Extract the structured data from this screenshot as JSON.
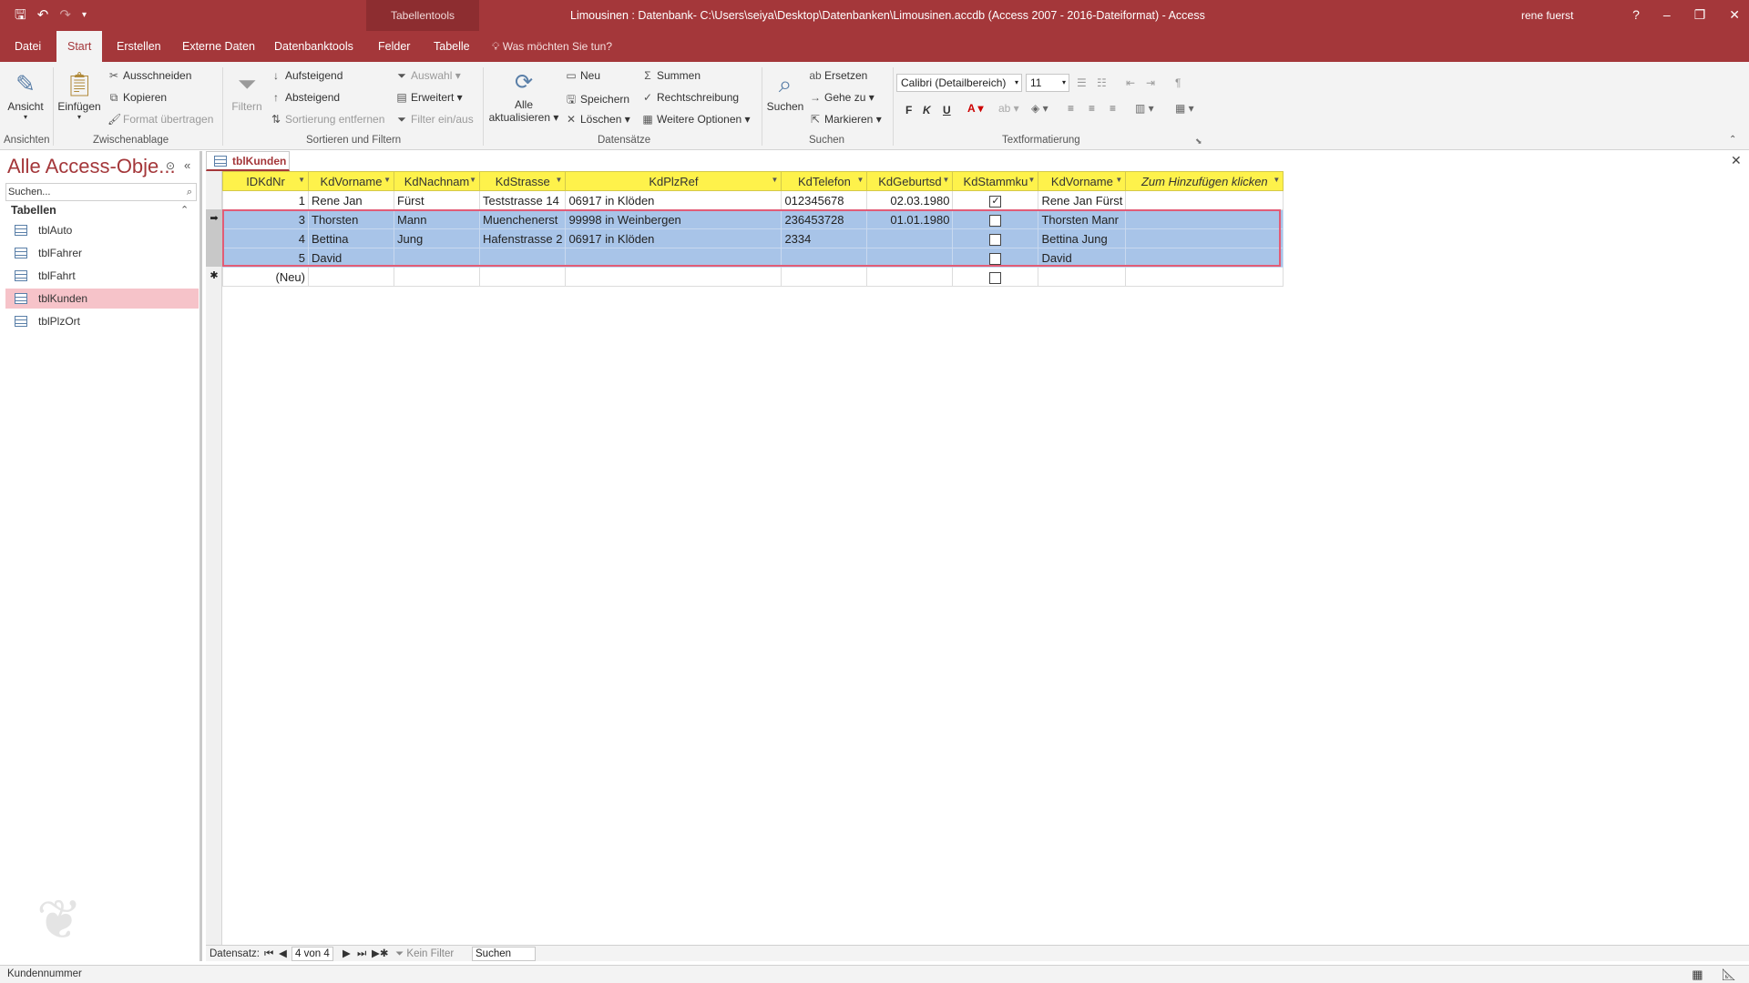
{
  "titlebar": {
    "tooltab": "Tabellentools",
    "title": "Limousinen : Datenbank- C:\\Users\\seiya\\Desktop\\Datenbanken\\Limousinen.accdb (Access 2007 - 2016-Dateiformat)  -  Access",
    "user": "rene fuerst",
    "help": "?",
    "minimize": "–",
    "restore": "❐",
    "close": "✕"
  },
  "tabs": {
    "datei": "Datei",
    "start": "Start",
    "erstellen": "Erstellen",
    "externe": "Externe Daten",
    "dbtools": "Datenbanktools",
    "felder": "Felder",
    "tabelle": "Tabelle",
    "tellme": "Was möchten Sie tun?"
  },
  "ribbon": {
    "ansicht": "Ansicht",
    "einfuegen": "Einfügen",
    "ausschneiden": "Ausschneiden",
    "kopieren": "Kopieren",
    "format_uebertragen": "Format übertragen",
    "filtern": "Filtern",
    "aufsteigend": "Aufsteigend",
    "absteigend": "Absteigend",
    "sortierung_entfernen": "Sortierung entfernen",
    "auswahl": "Auswahl",
    "erweitert": "Erweitert",
    "filter_einaus": "Filter ein/aus",
    "alle_aktualisieren_1": "Alle",
    "alle_aktualisieren_2": "aktualisieren",
    "neu": "Neu",
    "speichern": "Speichern",
    "loeschen": "Löschen",
    "summen": "Summen",
    "rechtschreibung": "Rechtschreibung",
    "weitere_optionen": "Weitere Optionen",
    "suchen": "Suchen",
    "ersetzen": "Ersetzen",
    "gehe_zu": "Gehe zu",
    "markieren": "Markieren",
    "font_name": "Calibri (Detailbereich)",
    "font_size": "11",
    "bold": "F",
    "italic": "K",
    "underline": "U",
    "groups": {
      "ansichten": "Ansichten",
      "zwischenablage": "Zwischenablage",
      "sortieren": "Sortieren und Filtern",
      "datensaetze": "Datensätze",
      "suchen": "Suchen",
      "textformatierung": "Textformatierung"
    }
  },
  "nav": {
    "header": "Alle Access-Obje...",
    "search_placeholder": "Suchen...",
    "section": "Tabellen",
    "items": [
      "tblAuto",
      "tblFahrer",
      "tblFahrt",
      "tblKunden",
      "tblPlzOrt"
    ],
    "selected": "tblKunden"
  },
  "document": {
    "tab": "tblKunden",
    "columns": [
      "IDKdNr",
      "KdVorname",
      "KdNachnam",
      "KdStrasse",
      "KdPlzRef",
      "KdTelefon",
      "KdGeburtsd",
      "KdStammku",
      "KdVorname",
      "Zum Hinzufügen klicken"
    ],
    "rows": [
      {
        "id": "1",
        "vorname": "Rene Jan",
        "nachname": "Fürst",
        "strasse": "Teststrasse 14",
        "plz": "06917 in Klöden",
        "telefon": "012345678",
        "geburt": "02.03.1980",
        "stammkunde": true,
        "vollname": "Rene Jan Fürst",
        "selected": false
      },
      {
        "id": "3",
        "vorname": "Thorsten",
        "nachname": "Mann",
        "strasse": "Muenchenerst",
        "plz": "99998 in Weinbergen",
        "telefon": "236453728",
        "geburt": "01.01.1980",
        "stammkunde": false,
        "vollname": "Thorsten Manr",
        "selected": true
      },
      {
        "id": "4",
        "vorname": "Bettina",
        "nachname": "Jung",
        "strasse": "Hafenstrasse 2",
        "plz": "06917 in Klöden",
        "telefon": "2334",
        "geburt": "",
        "stammkunde": false,
        "vollname": "Bettina Jung",
        "selected": true
      },
      {
        "id": "5",
        "vorname": "David",
        "nachname": "",
        "strasse": "",
        "plz": "",
        "telefon": "",
        "geburt": "",
        "stammkunde": false,
        "vollname": "David",
        "selected": true
      }
    ],
    "new_row_label": "(Neu)"
  },
  "recnav": {
    "label": "Datensatz:",
    "position": "4 von 4",
    "filter": "Kein Filter",
    "search": "Suchen"
  },
  "status": {
    "text": "Kundennummer"
  },
  "colors": {
    "accent": "#a4373a",
    "header_yellow": "#fef24b",
    "selection": "#a8c4e8",
    "nav_selected": "#f6c3c9"
  }
}
